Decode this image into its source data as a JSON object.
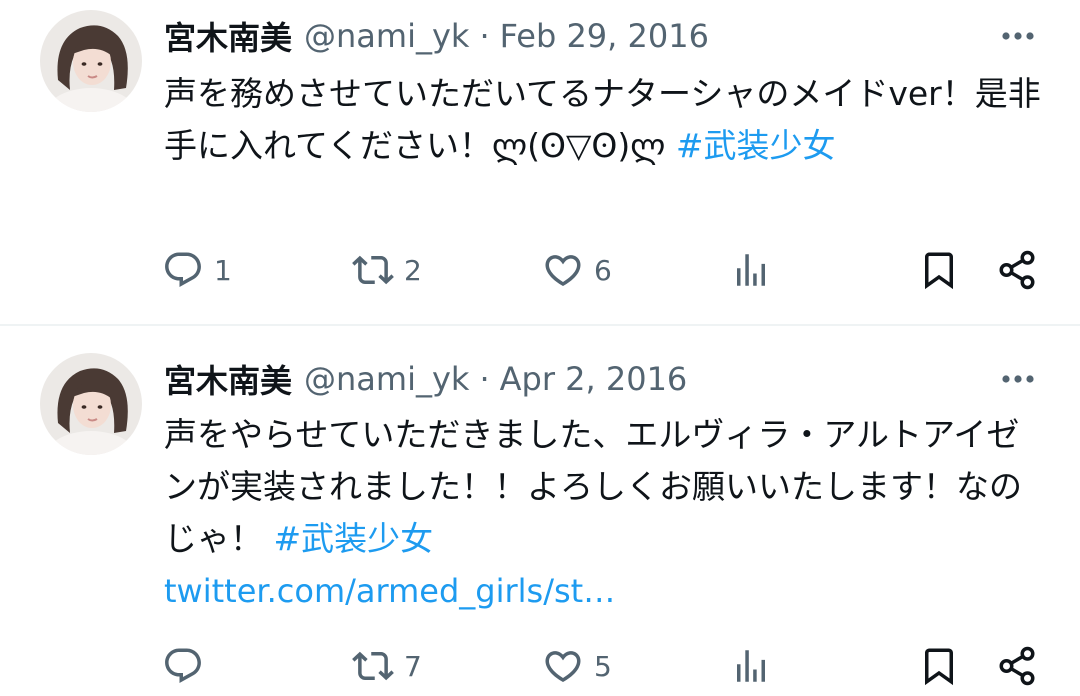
{
  "tweets": [
    {
      "author_name": "宮木南美",
      "handle": "@nami_yk",
      "separator": "·",
      "date": "Feb 29, 2016",
      "text": "声を務めさせていただいてるナターシャのメイドver！是非手に入れてください！ლ(ʘ▽ʘ)ლ ",
      "hashtag": "#武装少女",
      "link": "",
      "replies": "1",
      "retweets": "2",
      "likes": "6"
    },
    {
      "author_name": "宮木南美",
      "handle": "@nami_yk",
      "separator": "·",
      "date": "Apr 2, 2016",
      "text": "声をやらせていただきました、エルヴィラ・アルトアイゼンが実装されました！！よろしくお願いいたします！なのじゃ！ ",
      "hashtag": "#武装少女",
      "link": "twitter.com/armed_girls/st…",
      "replies": "",
      "retweets": "7",
      "likes": "5"
    }
  ],
  "icons": {
    "more": "more-horizontal-icon",
    "reply": "reply-icon",
    "retweet": "retweet-icon",
    "like": "heart-icon",
    "views": "analytics-icon",
    "bookmark": "bookmark-icon",
    "share": "share-icon"
  },
  "colors": {
    "text": "#0f1419",
    "secondary": "#536471",
    "accent": "#1d9bf0",
    "divider": "#eff3f4"
  }
}
